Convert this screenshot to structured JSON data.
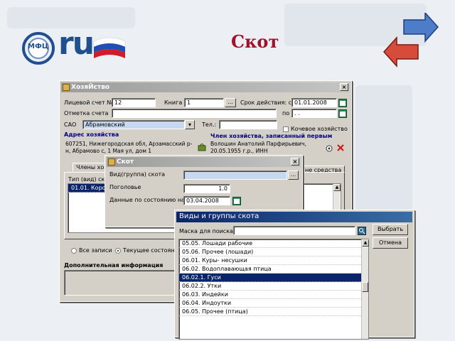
{
  "slide": {
    "title": "Скот",
    "logo_text": "ru",
    "logo_badge": "МФЦ"
  },
  "household_window": {
    "title": "ХозяЙство",
    "account_label": "Лицевой счет №",
    "account_value": "12",
    "book_label": "Книга",
    "book_value": "1",
    "period_label": "Срок действия: с",
    "period_from": "01.01.2008",
    "account_mark_label": "Отметка счета",
    "to_label": "по",
    "to_value": ". .",
    "sao_label": "САО",
    "sao_value": "Абрамовский",
    "phone_label": "Тел.:",
    "nomad_label": "Кочевое хозяйство",
    "address_header": "Адрес хозяйства",
    "address_text": "607251, Нижегородская обл, Арзамасский р-н, Абрамово с, 1 Мая ул, дом 1",
    "member_header": "Член хозяйства, записанный первым",
    "member_text": "Волошин Анатолий Парфирьевич, 20.05.1955 г.р., ИНН",
    "tab_members": "Члены хозяй",
    "tab_means": "не средства",
    "type_col": "Тип (вид) ско",
    "list_first": "01.01. Коров",
    "radio_all": "Все записи",
    "radio_current": "Текущее состояние",
    "extra_info_label": "Дополнительная информация"
  },
  "livestock_dialog": {
    "title": "Скот",
    "group_label": "Вид(группа) скота",
    "head_label": "Поголовье",
    "head_value": "1.0",
    "date_label": "Данные по состоянию на:",
    "date_value": "03.04.2008"
  },
  "groups_window": {
    "title": "Виды и группы скота",
    "mask_label": "Маска для поиска",
    "select_button": "Выбрать",
    "cancel_button": "Отмена",
    "items": [
      {
        "label": "05.05. Лошади рабочие",
        "selected": false
      },
      {
        "label": "05.06. Прочее (лошади)",
        "selected": false
      },
      {
        "label": "06.01. Куры- несушки",
        "selected": false
      },
      {
        "label": "06.02. Водоплавающая птица",
        "selected": false
      },
      {
        "label": "06.02.1. Гуси",
        "selected": true
      },
      {
        "label": "06.02.2. Утки",
        "selected": false
      },
      {
        "label": "06.03. Индейки",
        "selected": false
      },
      {
        "label": "06.04. Индоутки",
        "selected": false
      },
      {
        "label": "06.05. Прочее (птица)",
        "selected": false
      }
    ]
  },
  "colors": {
    "accent": "#0a246a",
    "title_red": "#a0112a",
    "highlight_field": "#c7d9f1"
  }
}
